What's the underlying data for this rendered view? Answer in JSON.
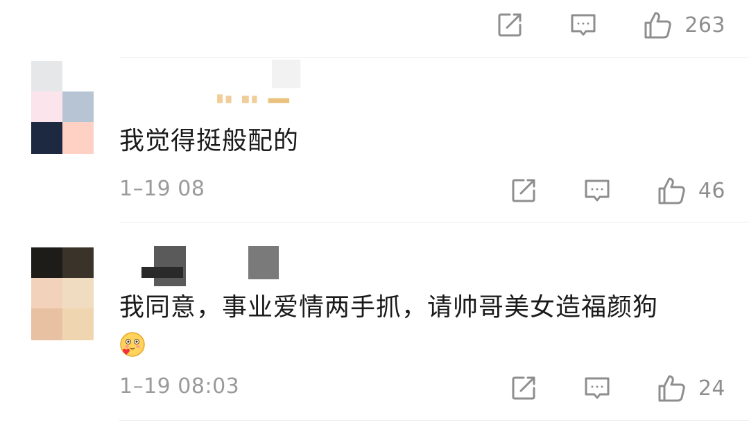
{
  "comments": [
    {
      "id": "top-partial",
      "likes": "263"
    },
    {
      "id": "comment-2",
      "text": "我觉得挺般配的",
      "timestamp": "1–19 08",
      "likes": "46"
    },
    {
      "id": "comment-3",
      "text": "我同意，事业爱情两手抓，请帅哥美女造福颜狗",
      "timestamp": "1–19 08:03",
      "likes": "24"
    }
  ],
  "icons": {
    "share": "share-icon",
    "reply": "comment-icon",
    "like": "thumbs-up-icon"
  },
  "colors": {
    "icon": "#8e8e8e",
    "text": "#1a1a1a",
    "meta": "#9a9a9a",
    "divider": "#ececec"
  }
}
